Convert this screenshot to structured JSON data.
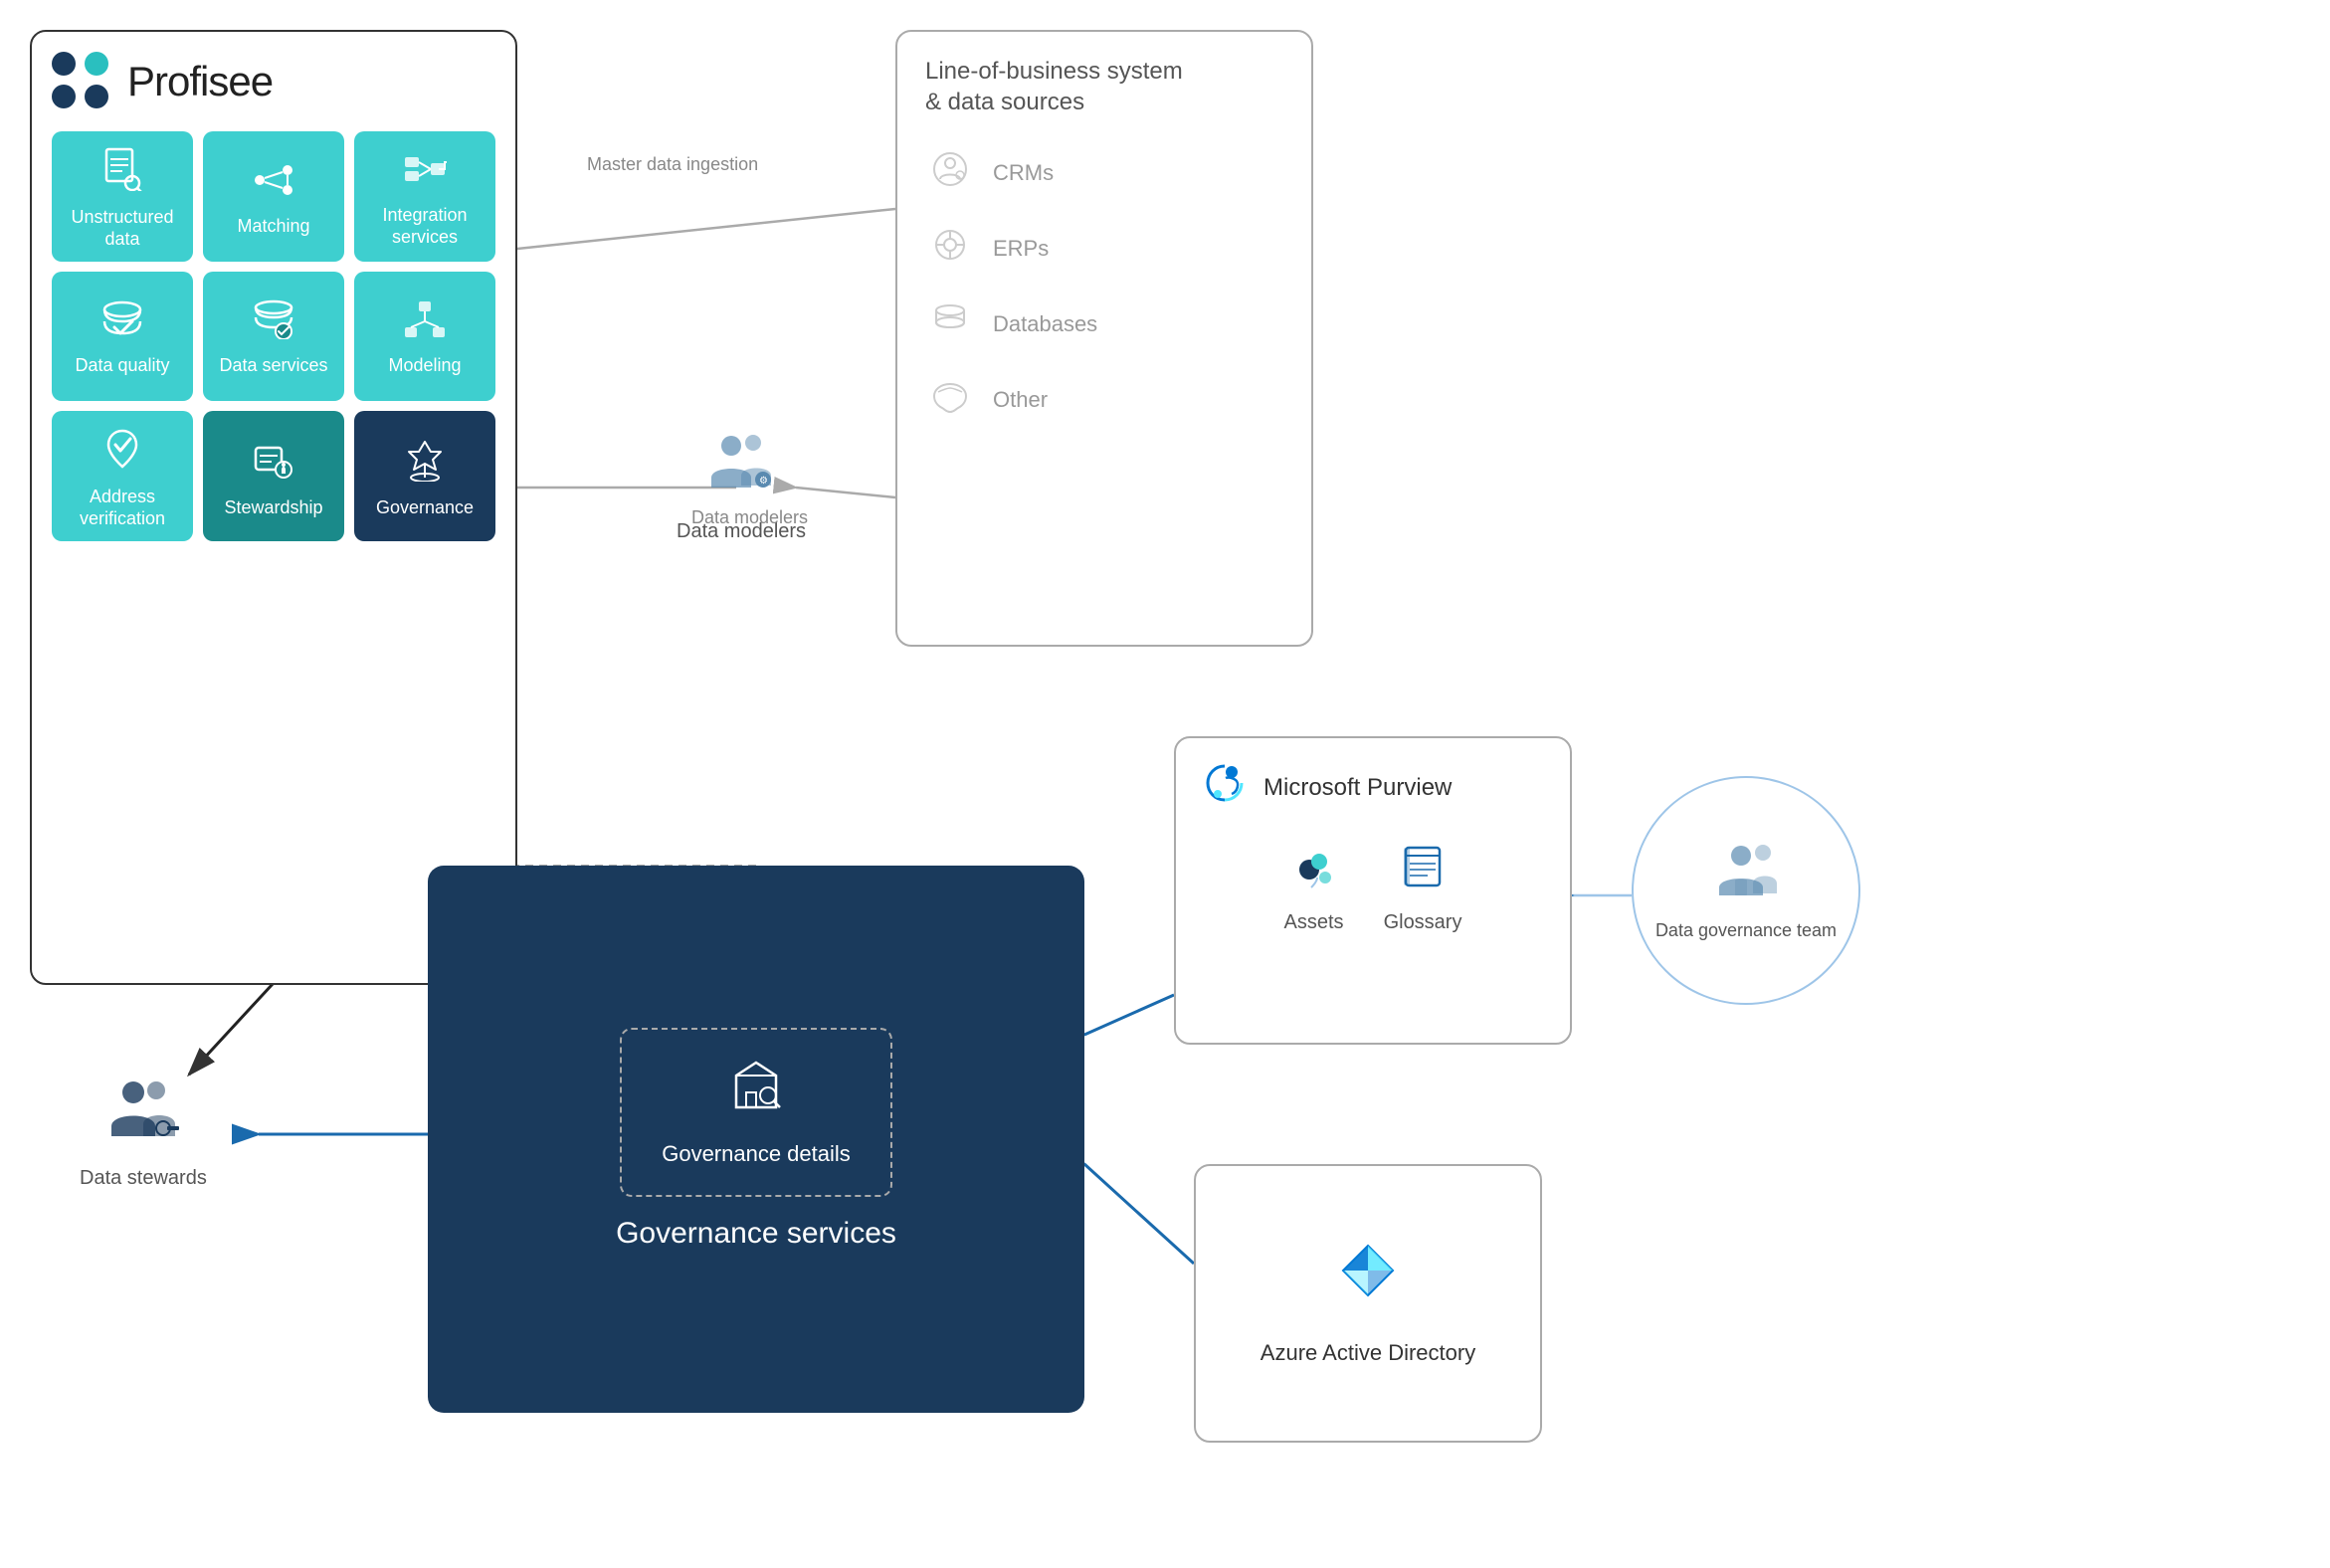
{
  "profisee": {
    "title": "Profisee",
    "modules": [
      {
        "id": "unstructured-data",
        "label": "Unstructured data",
        "icon": "📄",
        "style": "teal"
      },
      {
        "id": "matching",
        "label": "Matching",
        "icon": "⚡",
        "style": "teal"
      },
      {
        "id": "integration-services",
        "label": "Integration services",
        "icon": "🔀",
        "style": "teal"
      },
      {
        "id": "data-quality",
        "label": "Data quality",
        "icon": "💾",
        "style": "teal"
      },
      {
        "id": "data-services",
        "label": "Data services",
        "icon": "⚙️",
        "style": "teal"
      },
      {
        "id": "modeling",
        "label": "Modeling",
        "icon": "🔲",
        "style": "teal"
      },
      {
        "id": "address-verification",
        "label": "Address verification",
        "icon": "📍",
        "style": "teal"
      },
      {
        "id": "stewardship",
        "label": "Stewardship",
        "icon": "🔑",
        "style": "dark-teal"
      },
      {
        "id": "governance",
        "label": "Governance",
        "icon": "🏛️",
        "style": "dark-navy"
      }
    ]
  },
  "lob": {
    "title": "Line-of-business system\n& data sources",
    "items": [
      {
        "id": "crms",
        "label": "CRMs",
        "icon": "⚙️"
      },
      {
        "id": "erps",
        "label": "ERPs",
        "icon": "⚙️"
      },
      {
        "id": "databases",
        "label": "Databases",
        "icon": "🗄️"
      },
      {
        "id": "other",
        "label": "Other",
        "icon": "☁️"
      }
    ]
  },
  "arrows": {
    "master_data_ingestion": "Master data\ningestion",
    "data_modelers": "Data\nmodelers"
  },
  "purview": {
    "title": "Microsoft Purview",
    "items": [
      {
        "id": "assets",
        "label": "Assets",
        "icon": "🔷"
      },
      {
        "id": "glossary",
        "label": "Glossary",
        "icon": "📘"
      }
    ]
  },
  "azure": {
    "title": "Azure Active Directory",
    "icon": "🔷"
  },
  "gov_team": {
    "label": "Data\ngovernance\nteam",
    "icon": "👥"
  },
  "gov_services": {
    "label": "Governance\nservices",
    "details_label": "Governance\ndetails",
    "details_icon": "🏛️"
  },
  "data_stewards": {
    "label": "Data\nstewards",
    "icon": "👥"
  }
}
